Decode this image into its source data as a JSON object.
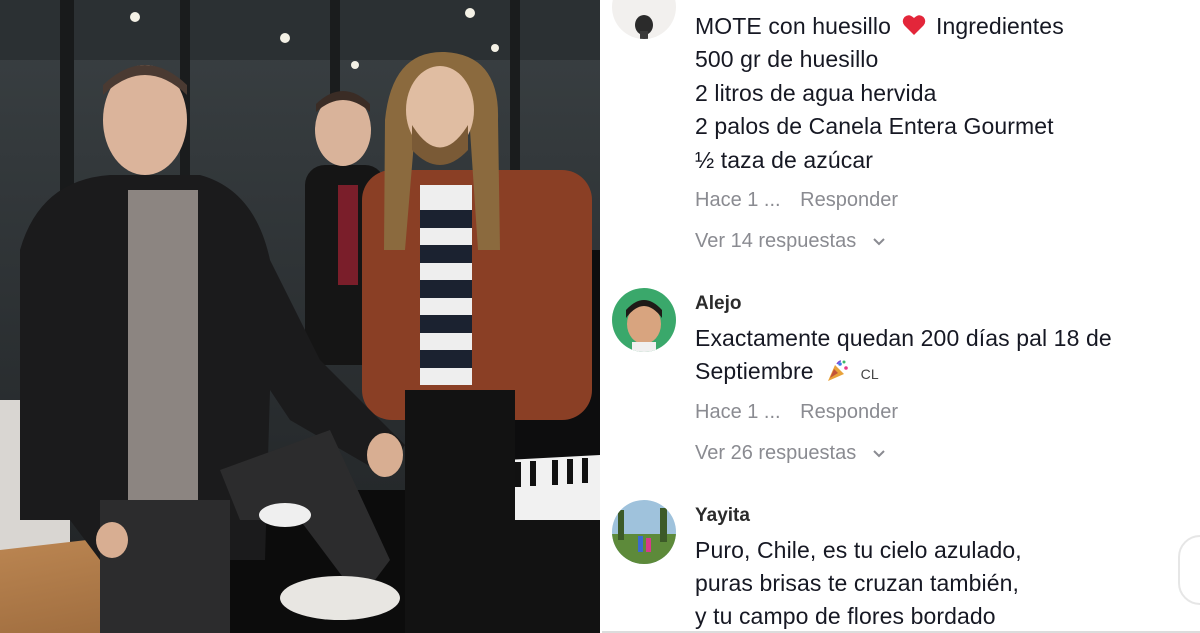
{
  "comments": [
    {
      "username": "",
      "lines": [
        "MOTE con huesillo",
        "500 gr de huesillo",
        "2 litros de agua hervida",
        "2 palos de Canela Entera Gourmet",
        "½ taza de azúcar"
      ],
      "line1_suffix": "Ingredientes",
      "heart_icon": "red-heart-icon",
      "time": "Hace 1 ...",
      "reply_label": "Responder",
      "view_replies": "Ver 14 respuestas"
    },
    {
      "username": "Alejo",
      "lines": [
        "Exactamente quedan 200 días pal 18 de",
        "Septiembre"
      ],
      "emoji_icon": "party-popper-icon",
      "country_tag": "CL",
      "time": "Hace 1 ...",
      "reply_label": "Responder",
      "view_replies": "Ver 26 respuestas"
    },
    {
      "username": "Yayita",
      "lines": [
        "Puro, Chile, es tu cielo azulado,",
        "puras brisas te cruzan también,",
        "y tu campo de flores bordado"
      ]
    }
  ],
  "colors": {
    "text": "#161823",
    "muted": "#8a8b91",
    "heart": "#e3263a"
  }
}
